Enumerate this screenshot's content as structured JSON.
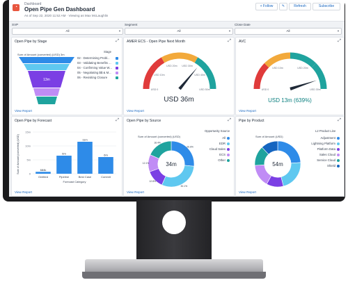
{
  "header": {
    "subtitle": "Dashboard",
    "title": "Open Pipe Gen Dashboard",
    "meta": "As of Sep 22, 2020 11:52 AM · Viewing as Max McLaughlin",
    "follow_label": "+ Follow",
    "refresh_label": "Refresh",
    "subscribe_label": "Subscribe"
  },
  "filters": [
    {
      "label": "SVP",
      "value": "All"
    },
    {
      "label": "Segment",
      "value": "All"
    },
    {
      "label": "Close Date",
      "value": "All"
    }
  ],
  "common": {
    "view_report": "View Report"
  },
  "stage_card": {
    "title": "Open Pipe by Stage",
    "axis_title": "Sum of Amount (converted) (USD)",
    "amount_suffix": "3m",
    "legend_title": "Stage",
    "center_value": "13m",
    "stages": [
      {
        "label": "02 - Determining Probl...",
        "color": "#2e8be8"
      },
      {
        "label": "03 - Validating Benefits ...",
        "color": "#5fc8f0"
      },
      {
        "label": "04 - Confirming Value W...",
        "color": "#7b3fe4"
      },
      {
        "label": "05 - Negotiating $$ & M...",
        "color": "#c08cf5"
      },
      {
        "label": "06 - Revisiting Closure",
        "color": "#1fa39e"
      }
    ]
  },
  "amer_card": {
    "title": "AMER ECS - Open Pipe Next Month",
    "value": "USD 36m",
    "gauge_labels": [
      "USD 0",
      "USD 10m",
      "USD 20m",
      "USD 30m",
      "USD 40m",
      "USD 50m"
    ],
    "needle_fraction": 0.72
  },
  "avc_card": {
    "title": "AVC",
    "value": "USD 13m (639%)",
    "gauge_labels": [
      "USD 0",
      "USD 10m",
      "USD 20m",
      "USD 30m"
    ],
    "needle_fraction": 0.9
  },
  "forecast_card": {
    "title": "Open Pipe by Forecast",
    "ylabel": "Sum of Amount (converted) (USD)",
    "xlabel": "Forecast Category",
    "chart_data": {
      "type": "bar",
      "categories": [
        "Omitted",
        "Pipeline",
        "Best Case",
        "Commit"
      ],
      "values": [
        0.684,
        6.5,
        11.5,
        6
      ],
      "data_labels": [
        "684k",
        "6m",
        "11m",
        "6m"
      ],
      "y_ticks": [
        "0",
        "5m",
        "10m",
        "15m"
      ],
      "ylim": [
        0,
        15
      ],
      "bar_color": "#2e8be8"
    }
  },
  "source_card": {
    "title": "Open Pipe by Source",
    "axis_title": "Sum of Amount (converted) (USD)",
    "center_value": "34m",
    "legend_title": "Opportunity Source",
    "chart_data": {
      "type": "pie",
      "categories": [
        "All",
        "EDR",
        "Cloud Sales",
        "ECS",
        "Other"
      ],
      "values": [
        26.6,
        30.1,
        12.8,
        12.1,
        18.4
      ],
      "data_labels": [
        "26.6%",
        "30.1%",
        "12.8%",
        "12.1%",
        "18.4%"
      ],
      "colors": [
        "#2e8be8",
        "#5fc8f0",
        "#7b3fe4",
        "#c08cf5",
        "#1fa39e"
      ]
    }
  },
  "product_card": {
    "title": "Pipe by Product",
    "axis_title": "Sum of Amount (USD)",
    "center_value": "54m",
    "legend_title": "L2 Product Line",
    "chart_data": {
      "type": "pie",
      "categories": [
        "Adjustment",
        "Lightning Platform",
        "Platform Data",
        "Sales Cloud",
        "Service Cloud",
        "Shield"
      ],
      "values": [
        24,
        22,
        12,
        16,
        14,
        12
      ],
      "colors": [
        "#2e8be8",
        "#5fc8f0",
        "#7b3fe4",
        "#c08cf5",
        "#1fa39e",
        "#1565c0"
      ]
    }
  }
}
